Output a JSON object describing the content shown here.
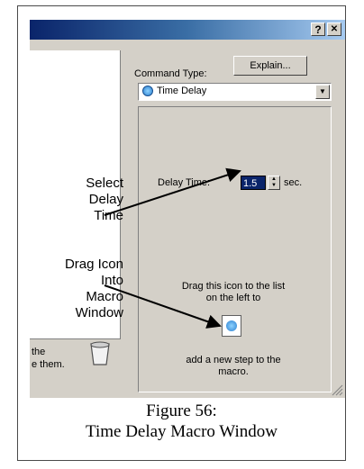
{
  "window": {
    "help_btn": "?",
    "close_btn": "✕",
    "explain_label": "Explain...",
    "command_type_label": "Command Type:",
    "command_type_value": "Time Delay",
    "delay_label": "Delay Time:",
    "delay_value": "1.5",
    "delay_unit": "sec.",
    "drag_text": "Drag this icon to the list on the left to",
    "add_text": "add a new step to the macro.",
    "left_fragment_1": "the",
    "left_fragment_2": "e them."
  },
  "annotations": {
    "select_delay": "Select Delay Time",
    "drag_icon": "Drag Icon Into Macro Window"
  },
  "caption": {
    "line1": "Figure 56:",
    "line2": "Time Delay Macro Window"
  },
  "colors": {
    "title_gradient_start": "#0a246a",
    "title_gradient_end": "#a6caf0",
    "window_face": "#d4d0c8",
    "selection": "#0a246a"
  },
  "icons": [
    "help-icon",
    "close-icon",
    "clock-icon",
    "dropdown-arrow-icon",
    "spin-up-icon",
    "spin-down-icon",
    "macro-step-icon",
    "trash-icon",
    "resize-grip-icon"
  ]
}
